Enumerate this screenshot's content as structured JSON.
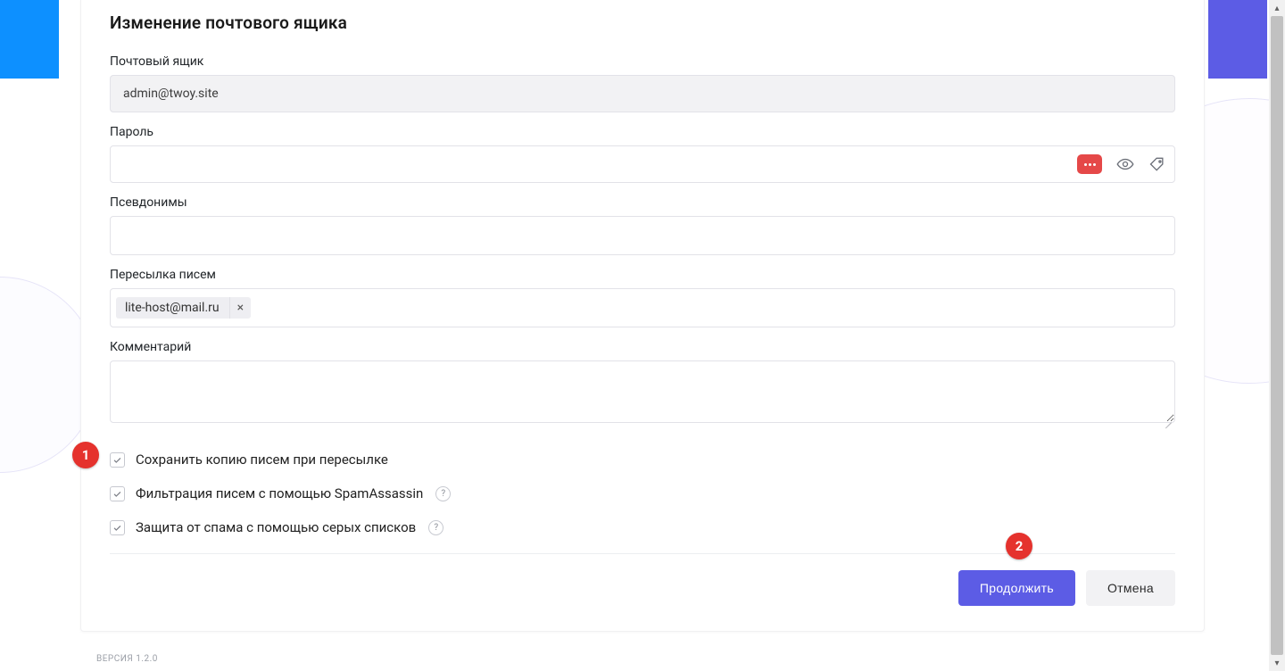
{
  "title": "Изменение почтового ящика",
  "fields": {
    "mailbox_label": "Почтовый ящик",
    "mailbox_value": "admin@twoy.site",
    "password_label": "Пароль",
    "password_value": "",
    "aliases_label": "Псевдонимы",
    "forward_label": "Пересылка писем",
    "forward_tag": "lite-host@mail.ru",
    "comment_label": "Комментарий",
    "comment_value": ""
  },
  "checks": {
    "save_copy": "Сохранить копию писем при пересылке",
    "spamassassin": "Фильтрация писем с помощью SpamAssassin",
    "greylist": "Защита от спама с помощью серых списков"
  },
  "buttons": {
    "continue": "Продолжить",
    "cancel": "Отмена"
  },
  "version": "ВЕРСИЯ 1.2.0",
  "icons": {
    "pwd_strength": "password-strength-dots",
    "eye": "eye-icon",
    "tag": "tag-icon",
    "help": "?",
    "tag_remove": "×"
  },
  "annotations": {
    "a1": "1",
    "a2": "2"
  }
}
